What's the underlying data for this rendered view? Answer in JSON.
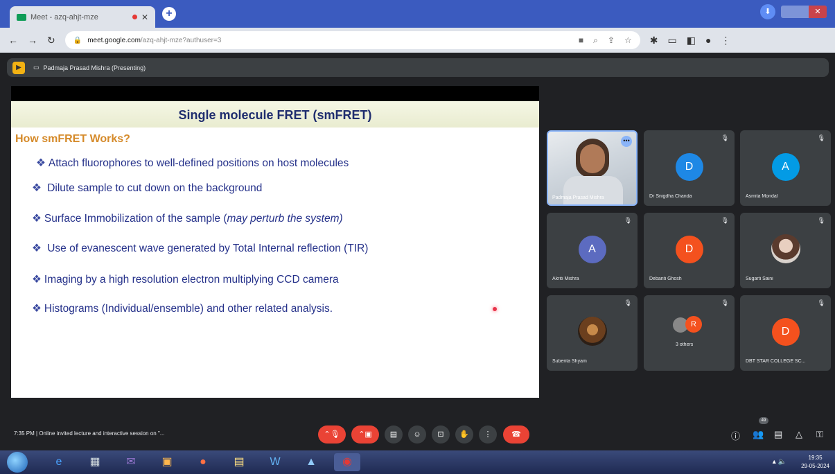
{
  "browser": {
    "tab_title": "Meet - azq-ahjt-mze",
    "url_host": "meet.google.com",
    "url_path": "/azq-ahjt-mze?authuser=3"
  },
  "meet": {
    "presenting_label": "Padmaja Prasad Mishra (Presenting)",
    "footer_info": "7:35 PM  |  Online invited lecture and interactive session on \"...",
    "people_count": "49"
  },
  "slide": {
    "title": "Single molecule FRET (smFRET)",
    "subtitle": "How smFRET Works?",
    "bullets": [
      "Attach fluorophores to  well-defined positions on  host molecules",
      "Dilute sample to cut down on the background",
      "Surface Immobilization of the sample (",
      "may perturb the system)",
      "Use of evanescent wave generated by Total Internal reflection (TIR)",
      "Imaging by a high resolution electron multiplying  CCD camera",
      "Histograms (Individual/ensemble) and other related analysis."
    ]
  },
  "participants": [
    {
      "name": "Padmaja Prasad Mishra",
      "initial": "",
      "color": ""
    },
    {
      "name": "Dr Snigdha Chanda",
      "initial": "D",
      "color": "#1e88e5"
    },
    {
      "name": "Asmita Mondal",
      "initial": "A",
      "color": "#039be5"
    },
    {
      "name": "Akriti Mishra",
      "initial": "A",
      "color": "#5c6bc0"
    },
    {
      "name": "Debanti Ghosh",
      "initial": "D",
      "color": "#f4511e"
    },
    {
      "name": "Sugarti Saini",
      "initial": "",
      "color": ""
    },
    {
      "name": "Suberita Shyam",
      "initial": "",
      "color": ""
    },
    {
      "name": "3 others",
      "initial": "R",
      "color": "#f4511e"
    },
    {
      "name": "DBT STAR COLLEGE SC...",
      "initial": "D",
      "color": "#f4511e"
    }
  ],
  "taskbar": {
    "time": "19:35",
    "date": "29-05-2024"
  }
}
